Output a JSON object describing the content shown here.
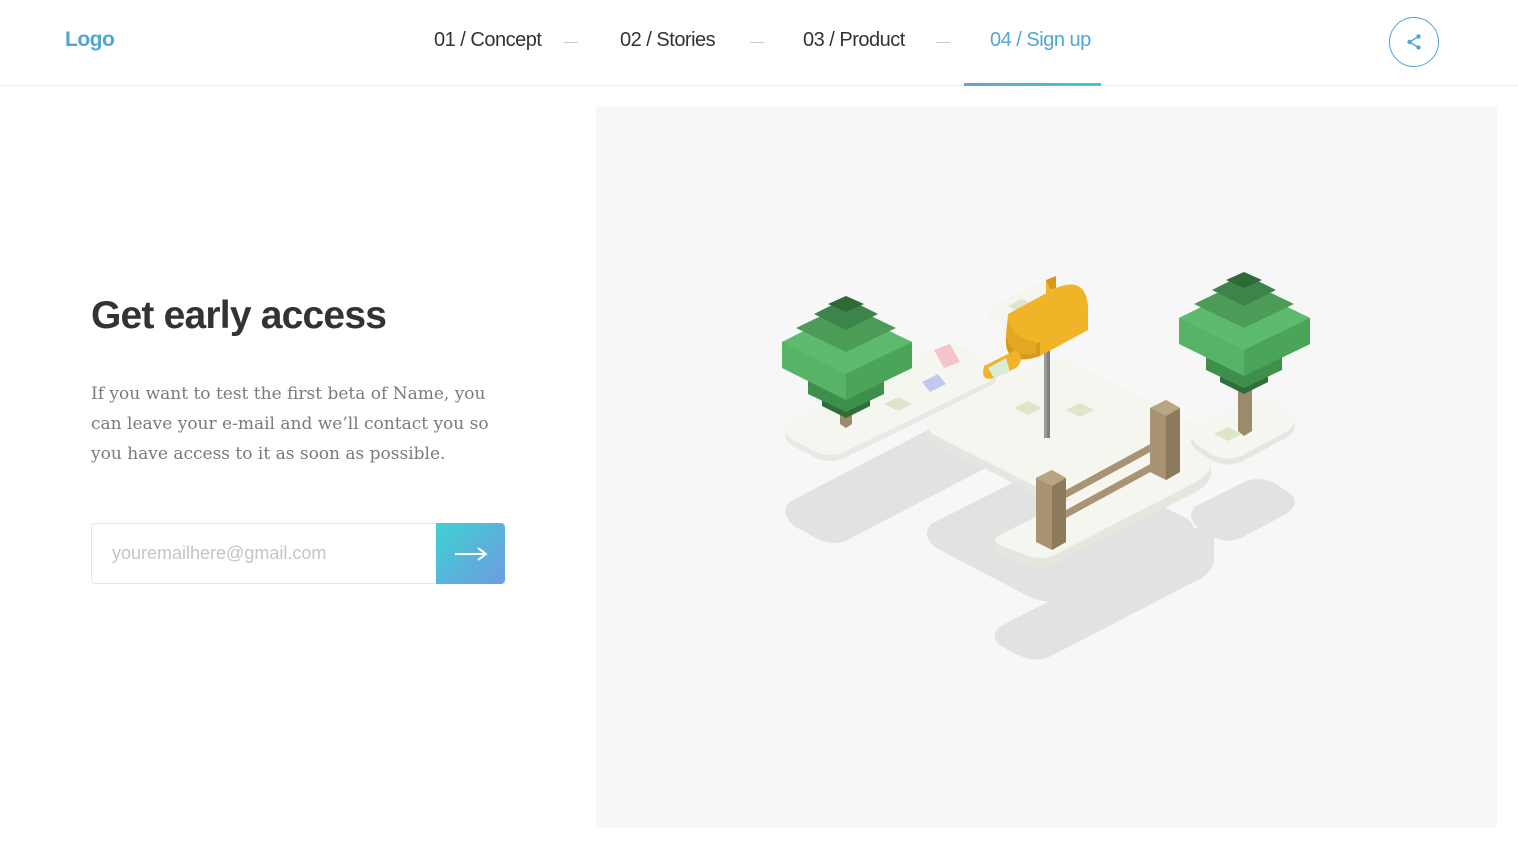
{
  "header": {
    "logo": "Logo",
    "nav": [
      {
        "label": "01 / Concept",
        "active": false
      },
      {
        "label": "02 / Stories",
        "active": false
      },
      {
        "label": "03 / Product",
        "active": false
      },
      {
        "label": "04 / Sign up",
        "active": true
      }
    ],
    "share_icon": "share-icon"
  },
  "main": {
    "headline": "Get early access",
    "description": "If you want to test the first beta of Name, you can leave your e-mail and we’ll contact you so you have access to it as soon as possible.",
    "email": {
      "placeholder": "youremailhere@gmail.com",
      "value": ""
    },
    "submit_icon": "arrow-right-icon"
  },
  "illustration": {
    "subject": "isometric-mailbox-scene"
  },
  "colors": {
    "accent": "#4fa6d6",
    "gradient_start": "#3fd1d4",
    "gradient_end": "#6e9be0",
    "text_dark": "#333333",
    "text_muted": "#7a7a7a",
    "illustration_bg": "#f7f7f7"
  }
}
